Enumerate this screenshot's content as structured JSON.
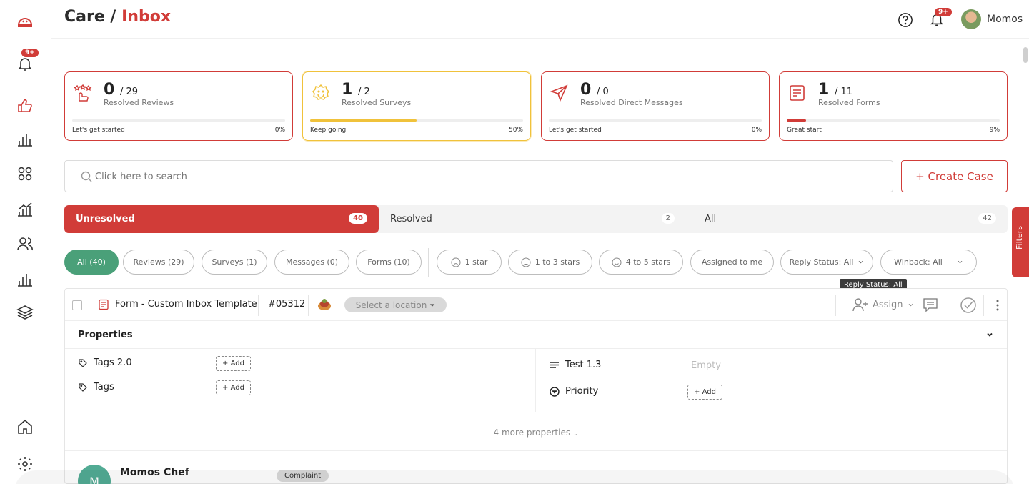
{
  "header": {
    "title_prefix": "Care /",
    "title_accent": "Inbox",
    "notif_badge": "9+",
    "username": "Momos"
  },
  "sidebar": {
    "notif_badge": "9+"
  },
  "stats": [
    {
      "count": "0",
      "total": "/ 29",
      "label": "Resolved Reviews",
      "msg": "Let's get started",
      "pct": "0%",
      "progress": 0
    },
    {
      "count": "1",
      "total": "/ 2",
      "label": "Resolved Surveys",
      "msg": "Keep going",
      "pct": "50%",
      "progress": 50
    },
    {
      "count": "0",
      "total": "/ 0",
      "label": "Resolved Direct Messages",
      "msg": "Let's get started",
      "pct": "0%",
      "progress": 0
    },
    {
      "count": "1",
      "total": "/ 11",
      "label": "Resolved Forms",
      "msg": "Great start",
      "pct": "9%",
      "progress": 9
    }
  ],
  "search": {
    "placeholder": "Click here to search"
  },
  "create_case": "+ Create Case",
  "status_tabs": [
    {
      "label": "Unresolved",
      "count": "40"
    },
    {
      "label": "Resolved",
      "count": "2"
    },
    {
      "label": "All",
      "count": "42"
    }
  ],
  "filters": {
    "all": "All (40)",
    "reviews": "Reviews (29)",
    "surveys": "Surveys (1)",
    "messages": "Messages (0)",
    "forms": "Forms (10)",
    "one_star": "1 star",
    "one_three": "1 to 3 stars",
    "four_five": "4 to 5 stars",
    "assigned": "Assigned to me",
    "reply_status": "Reply Status: All",
    "winback": "Winback: All"
  },
  "filters_tab": "Filters",
  "tooltip": "Reply Status: All",
  "case": {
    "title": "Form - Custom Inbox Template",
    "id": "#05312",
    "location_placeholder": "Select a location",
    "assign": "Assign",
    "properties_title": "Properties",
    "properties": {
      "tags2": "Tags 2.0",
      "tags": "Tags",
      "test": "Test 1.3",
      "test_value": "Empty",
      "priority": "Priority",
      "add_label": "+ Add"
    },
    "more_properties": "4 more properties",
    "customer_initial": "M",
    "customer_name": "Momos Chef",
    "tag": "Complaint"
  },
  "colors": {
    "accent": "#d13c38",
    "yellow": "#f0c23b",
    "green": "#4aa079"
  }
}
